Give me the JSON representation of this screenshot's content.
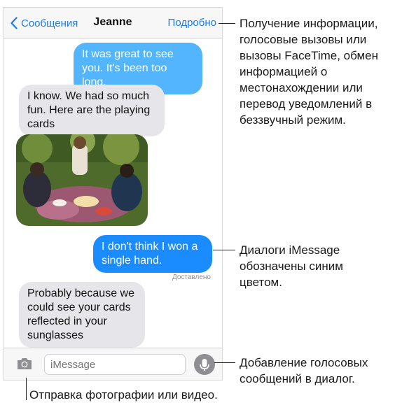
{
  "navbar": {
    "back_label": "Сообщения",
    "contact_name": "Jeanne",
    "details_label": "Подробно"
  },
  "messages": [
    {
      "direction": "outgoing",
      "text": "It was great to see you. It's been too long."
    },
    {
      "direction": "incoming",
      "text": "I know. We had so much fun. Here are the playing cards"
    },
    {
      "direction": "incoming",
      "type": "photo"
    },
    {
      "direction": "outgoing",
      "text": "I don't think I won a single hand."
    },
    {
      "direction": "incoming",
      "text": "Probably because we could see your cards reflected in your sunglasses"
    }
  ],
  "delivered_label": "Доставлено",
  "input": {
    "placeholder": "iMessage"
  },
  "callouts": {
    "details": "Получение информации, голосовые вызовы или вызовы FaceTime, обмен информацией о местонахождении или перевод уведомлений в беззвучный режим.",
    "imessage": "Диалоги iMessage обозначены синим цветом.",
    "voice": "Добавление голосовых сообщений в диалог.",
    "camera": "Отправка фотографии или видео."
  },
  "colors": {
    "accent": "#1a7cf0",
    "outgoing_bubble": "#54b5ff",
    "incoming_bubble": "#e6e6ea"
  },
  "icons": [
    "chevron-left-icon",
    "camera-icon",
    "microphone-icon"
  ]
}
